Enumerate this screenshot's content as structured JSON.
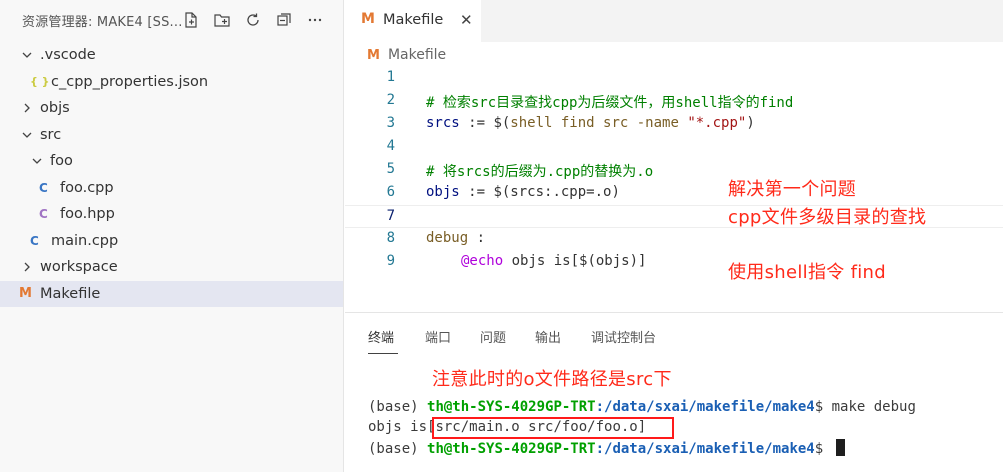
{
  "sidebar": {
    "title": "资源管理器: MAKE4 [SS...",
    "actions": [
      "new-file-icon",
      "new-folder-icon",
      "refresh-icon",
      "collapse-all-icon",
      "more-icon"
    ],
    "tree": [
      {
        "label": ".vscode",
        "kind": "folder",
        "expanded": true,
        "depth": 0
      },
      {
        "label": "c_cpp_properties.json",
        "kind": "json",
        "depth": 1
      },
      {
        "label": "objs",
        "kind": "folder",
        "expanded": false,
        "depth": 0
      },
      {
        "label": "src",
        "kind": "folder",
        "expanded": true,
        "depth": 0
      },
      {
        "label": "foo",
        "kind": "folder",
        "expanded": true,
        "depth": 1
      },
      {
        "label": "foo.cpp",
        "kind": "cpp",
        "depth": 2
      },
      {
        "label": "foo.hpp",
        "kind": "hpp",
        "depth": 2
      },
      {
        "label": "main.cpp",
        "kind": "cpp",
        "depth": 1
      },
      {
        "label": "workspace",
        "kind": "folder",
        "expanded": false,
        "depth": 0
      },
      {
        "label": "Makefile",
        "kind": "makefile",
        "depth": 0,
        "selected": true
      }
    ],
    "icons": {
      "json": "{ }",
      "cpp": "C",
      "hpp": "C",
      "makefile": "M"
    }
  },
  "editor": {
    "tab_label": "Makefile",
    "tab_close": "✕",
    "tab_icon": "M",
    "breadcrumb": "Makefile",
    "line_numbers": [
      "1",
      "2",
      "3",
      "4",
      "5",
      "6",
      "7",
      "8",
      "9"
    ],
    "current_line": 7,
    "code": {
      "l2": "# 检索src目录查找cpp为后缀文件，用shell指令的find",
      "l3_var": "srcs",
      "l3_op": " := ",
      "l3_open": "$(",
      "l3_fn": "shell find src -name ",
      "l3_str": "\"*.cpp\"",
      "l3_close": ")",
      "l5": "# 将srcs的后缀为.cpp的替换为.o",
      "l6_var": "objs",
      "l6_op": " := ",
      "l6_expr": "$(srcs:.cpp=.o)",
      "l8_target": "debug",
      "l8_colon": " :",
      "l9_at": "@echo",
      "l9_rest": " objs is[$(objs)]"
    },
    "annotations": [
      "解决第一个问题",
      "cpp文件多级目录的查找",
      "使用shell指令 find"
    ]
  },
  "panel": {
    "tabs": [
      "终端",
      "端口",
      "问题",
      "输出",
      "调试控制台"
    ],
    "active_tab": "终端",
    "annotation": "注意此时的o文件路径是src下",
    "terminal": {
      "prefix": "(base) ",
      "user": "th@th-SYS-4029GP-TRT",
      "path": ":/data/sxai/makefile/make4",
      "prompt": "$ ",
      "command": "make debug",
      "output_label": "objs is",
      "output_value": "[src/main.o src/foo/foo.o]"
    }
  },
  "colors": {
    "annotation": "#ff2a1a",
    "makefile_icon": "#e37933",
    "cpp_icon": "#3a76c4",
    "hpp_icon": "#a074c4",
    "json_icon": "#cbcb41",
    "comment": "#008000",
    "term_user": "#00a000",
    "term_path": "#1a5fb4"
  }
}
